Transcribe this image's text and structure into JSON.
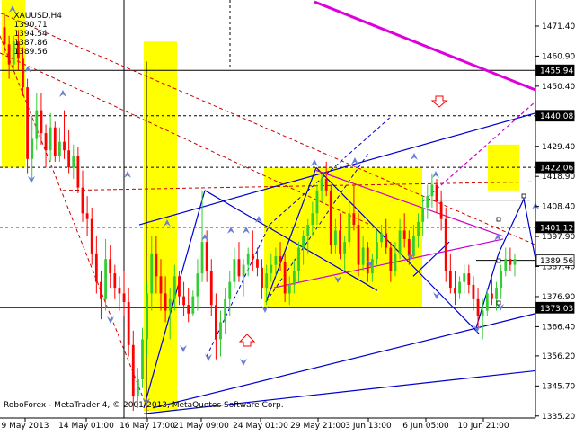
{
  "header": {
    "symbol": "XAUUSD,H4",
    "open": "1390.71",
    "high": "1394.54",
    "low": "1387.86",
    "close": "1389.56"
  },
  "footer": {
    "copyright": "RoboForex - MetaTrader 4, © 2001-2013, MetaQuotes Software Corp."
  },
  "colors": {
    "bull": "#32cd32",
    "bear": "#ff0000",
    "zone": "#ffff00",
    "trend": "#0000cd",
    "channel": "#cc00cc",
    "magenta": "#dd00dd",
    "arrow": "#6a80d8",
    "red_dash": "#cc0000"
  },
  "chart_data": {
    "type": "candlestick",
    "title": "XAUUSD,H4",
    "ylim": [
      1334.5,
      1480.5
    ],
    "y_ticks": [
      "1471.40",
      "1460.90",
      "1450.40",
      "1439.80",
      "1429.40",
      "1418.90",
      "1408.40",
      "1397.90",
      "1387.40",
      "1376.90",
      "1366.40",
      "1356.20",
      "1345.70",
      "1335.20"
    ],
    "x_ticks": [
      "9 May 2013",
      "14 May 01:00",
      "16 May 17:00",
      "21 May 09:00",
      "24 May 01:00",
      "29 May 21:00",
      "3 Jun 13:00",
      "6 Jun 05:00",
      "10 Jun 21:00"
    ],
    "price_tags": [
      {
        "label": "1455.94",
        "value": 1455.94,
        "style": "black"
      },
      {
        "label": "1440.08",
        "value": 1440.08,
        "style": "black"
      },
      {
        "label": "1422.06",
        "value": 1422.06,
        "style": "black"
      },
      {
        "label": "1401.12",
        "value": 1401.12,
        "style": "black"
      },
      {
        "label": "1389.56",
        "value": 1389.56,
        "style": "white"
      },
      {
        "label": "1373.03",
        "value": 1373.03,
        "style": "black"
      }
    ],
    "candles": [
      [
        1471,
        1476,
        1462,
        1465
      ],
      [
        1465,
        1468,
        1453,
        1458
      ],
      [
        1458,
        1468,
        1456,
        1466
      ],
      [
        1466,
        1470,
        1456,
        1460
      ],
      [
        1460,
        1464,
        1447,
        1450
      ],
      [
        1450,
        1453,
        1420,
        1425
      ],
      [
        1425,
        1440,
        1418,
        1432
      ],
      [
        1432,
        1448,
        1428,
        1442
      ],
      [
        1442,
        1448,
        1430,
        1434
      ],
      [
        1434,
        1437,
        1422,
        1428
      ],
      [
        1428,
        1441,
        1424,
        1436
      ],
      [
        1436,
        1438,
        1424,
        1426
      ],
      [
        1426,
        1436,
        1424,
        1431
      ],
      [
        1431,
        1442,
        1425,
        1428
      ],
      [
        1428,
        1435,
        1420,
        1422
      ],
      [
        1422,
        1430,
        1418,
        1426
      ],
      [
        1426,
        1429,
        1413,
        1415
      ],
      [
        1415,
        1421,
        1403,
        1406
      ],
      [
        1406,
        1412,
        1398,
        1404
      ],
      [
        1404,
        1408,
        1388,
        1392
      ],
      [
        1392,
        1398,
        1378,
        1382
      ],
      [
        1382,
        1386,
        1369,
        1376
      ],
      [
        1376,
        1397,
        1372,
        1390
      ],
      [
        1390,
        1395,
        1380,
        1385
      ],
      [
        1385,
        1388,
        1376,
        1380
      ],
      [
        1380,
        1384,
        1372,
        1378
      ],
      [
        1378,
        1386,
        1370,
        1375
      ],
      [
        1375,
        1380,
        1356,
        1360
      ],
      [
        1360,
        1365,
        1337,
        1342
      ],
      [
        1342,
        1352,
        1338,
        1348
      ],
      [
        1348,
        1366,
        1345,
        1362
      ],
      [
        1362,
        1382,
        1356,
        1378
      ],
      [
        1378,
        1398,
        1372,
        1392
      ],
      [
        1392,
        1398,
        1378,
        1384
      ],
      [
        1384,
        1390,
        1372,
        1378
      ],
      [
        1378,
        1384,
        1368,
        1372
      ],
      [
        1372,
        1380,
        1362,
        1376
      ],
      [
        1376,
        1388,
        1372,
        1384
      ],
      [
        1384,
        1386,
        1374,
        1377
      ],
      [
        1377,
        1382,
        1370,
        1374
      ],
      [
        1374,
        1380,
        1368,
        1371
      ],
      [
        1371,
        1379,
        1370,
        1377
      ],
      [
        1377,
        1390,
        1372,
        1385
      ],
      [
        1385,
        1414,
        1382,
        1396
      ],
      [
        1396,
        1400,
        1382,
        1386
      ],
      [
        1386,
        1390,
        1370,
        1374
      ],
      [
        1374,
        1378,
        1355,
        1362
      ],
      [
        1362,
        1372,
        1356,
        1368
      ],
      [
        1368,
        1380,
        1364,
        1376
      ],
      [
        1376,
        1386,
        1370,
        1382
      ],
      [
        1382,
        1394,
        1380,
        1390
      ],
      [
        1390,
        1396,
        1382,
        1384
      ],
      [
        1384,
        1390,
        1377,
        1388
      ],
      [
        1388,
        1394,
        1384,
        1392
      ],
      [
        1392,
        1400,
        1386,
        1390
      ],
      [
        1390,
        1394,
        1384,
        1387
      ],
      [
        1387,
        1390,
        1376,
        1380
      ],
      [
        1380,
        1388,
        1374,
        1385
      ],
      [
        1385,
        1392,
        1382,
        1388
      ],
      [
        1388,
        1394,
        1384,
        1391
      ],
      [
        1391,
        1396,
        1386,
        1389
      ],
      [
        1389,
        1392,
        1375,
        1378
      ],
      [
        1378,
        1384,
        1374,
        1381
      ],
      [
        1381,
        1390,
        1378,
        1386
      ],
      [
        1386,
        1396,
        1382,
        1394
      ],
      [
        1394,
        1400,
        1388,
        1398
      ],
      [
        1398,
        1404,
        1392,
        1402
      ],
      [
        1402,
        1410,
        1398,
        1406
      ],
      [
        1406,
        1416,
        1402,
        1414
      ],
      [
        1414,
        1420,
        1410,
        1418
      ],
      [
        1418,
        1424,
        1412,
        1414
      ],
      [
        1414,
        1416,
        1392,
        1395
      ],
      [
        1395,
        1404,
        1392,
        1400
      ],
      [
        1400,
        1406,
        1390,
        1392
      ],
      [
        1392,
        1398,
        1386,
        1396
      ],
      [
        1396,
        1410,
        1394,
        1406
      ],
      [
        1406,
        1416,
        1400,
        1402
      ],
      [
        1402,
        1406,
        1384,
        1388
      ],
      [
        1388,
        1398,
        1386,
        1394
      ],
      [
        1394,
        1396,
        1382,
        1385
      ],
      [
        1385,
        1392,
        1382,
        1390
      ],
      [
        1390,
        1400,
        1388,
        1396
      ],
      [
        1396,
        1402,
        1394,
        1399
      ],
      [
        1399,
        1404,
        1392,
        1394
      ],
      [
        1394,
        1396,
        1382,
        1386
      ],
      [
        1386,
        1396,
        1384,
        1392
      ],
      [
        1392,
        1404,
        1390,
        1400
      ],
      [
        1400,
        1406,
        1394,
        1397
      ],
      [
        1397,
        1400,
        1388,
        1391
      ],
      [
        1391,
        1402,
        1390,
        1398
      ],
      [
        1398,
        1406,
        1394,
        1403
      ],
      [
        1403,
        1412,
        1398,
        1408
      ],
      [
        1408,
        1416,
        1404,
        1412
      ],
      [
        1412,
        1420,
        1408,
        1416
      ],
      [
        1416,
        1418,
        1406,
        1410
      ],
      [
        1410,
        1414,
        1400,
        1404
      ],
      [
        1404,
        1408,
        1382,
        1386
      ],
      [
        1386,
        1392,
        1378,
        1380
      ],
      [
        1380,
        1386,
        1374,
        1378
      ],
      [
        1378,
        1384,
        1376,
        1382
      ],
      [
        1382,
        1388,
        1378,
        1385
      ],
      [
        1385,
        1388,
        1378,
        1381
      ],
      [
        1381,
        1384,
        1372,
        1376
      ],
      [
        1376,
        1380,
        1366,
        1370
      ],
      [
        1370,
        1376,
        1362,
        1372
      ],
      [
        1372,
        1380,
        1370,
        1378
      ],
      [
        1378,
        1384,
        1374,
        1376
      ],
      [
        1376,
        1382,
        1372,
        1380
      ],
      [
        1380,
        1388,
        1376,
        1386
      ],
      [
        1386,
        1394,
        1384,
        1390
      ],
      [
        1390,
        1394,
        1386,
        1388
      ],
      [
        1388,
        1392,
        1384,
        1390
      ]
    ]
  }
}
